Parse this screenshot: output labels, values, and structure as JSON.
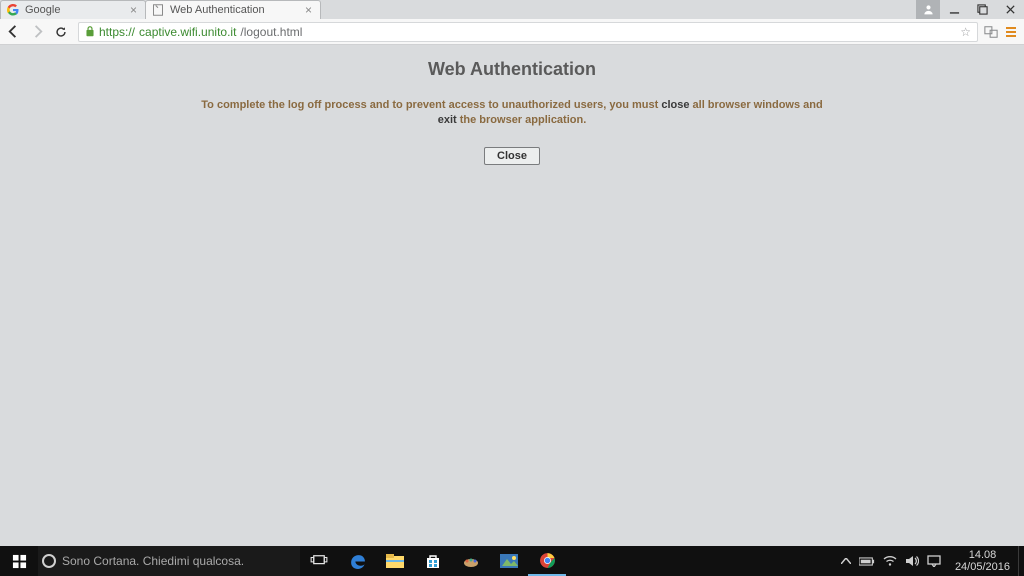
{
  "browser": {
    "tabs": [
      {
        "title": "Google",
        "active": false
      },
      {
        "title": "Web Authentication",
        "active": true
      }
    ],
    "url": {
      "scheme": "https://",
      "host": "captive.wifi.unito.it",
      "path": "/logout.html"
    }
  },
  "page": {
    "heading": "Web Authentication",
    "msg_pre": "To complete the log off process and to prevent access to unauthorized users, you must ",
    "msg_bold1": "close",
    "msg_mid": " all browser windows and ",
    "msg_bold2": "exit",
    "msg_post": " the browser application.",
    "close_btn": "Close"
  },
  "taskbar": {
    "cortana_placeholder": "Sono Cortana. Chiedimi qualcosa.",
    "time": "14.08",
    "date": "24/05/2016"
  }
}
